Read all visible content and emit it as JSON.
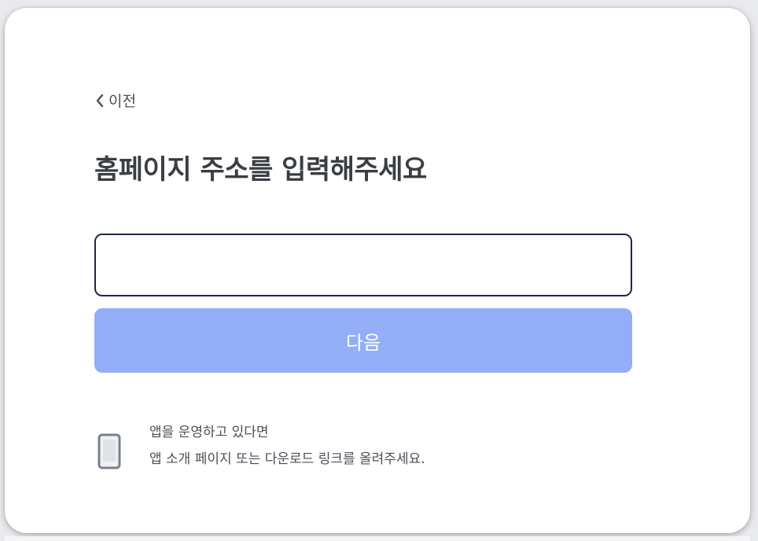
{
  "nav": {
    "back_label": "이전",
    "back_icon": "chevron-left-icon"
  },
  "page": {
    "title": "홈페이지 주소를 입력해주세요"
  },
  "form": {
    "url_value": "",
    "url_placeholder": "",
    "next_label": "다음"
  },
  "app_notice": {
    "icon": "smartphone-icon",
    "line1": "앱을 운영하고 있다면",
    "line2": "앱 소개 페이지 또는 다운로드 링크를 올려주세요."
  },
  "colors": {
    "button_bg": "#93aef7",
    "input_border": "#1e2a44",
    "title_text": "#3a3d44",
    "body_text": "#4b4f58"
  }
}
